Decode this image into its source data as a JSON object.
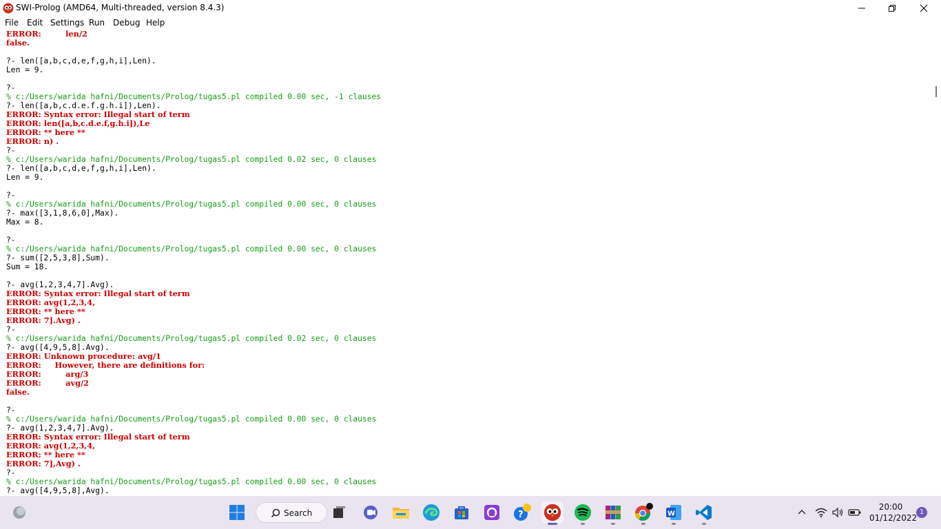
{
  "window": {
    "title": "SWI-Prolog (AMD64, Multi-threaded, version 8.4.3)",
    "controls": [
      "minimize",
      "restore",
      "close"
    ]
  },
  "menu": [
    "File",
    "Edit",
    "Settings",
    "Run",
    "Debug",
    "Help"
  ],
  "colors": {
    "error_text": "#cc0000",
    "comment_text": "#14a014",
    "normal_text": "#000000",
    "taskbar_bg": "#e9e4ef",
    "notification_badge": "#6f58b8"
  },
  "console": {
    "lines": [
      {
        "t": "ERROR:         len/2",
        "k": "error"
      },
      {
        "t": "false.",
        "k": "error"
      },
      {
        "t": "",
        "k": "normal"
      },
      {
        "t": "?- len([a,b,c,d,e,f,g,h,i],Len).",
        "k": "normal"
      },
      {
        "t": "Len = 9.",
        "k": "normal"
      },
      {
        "t": "",
        "k": "normal"
      },
      {
        "t": "?-",
        "k": "normal"
      },
      {
        "t": "% c:/Users/warida hafni/Documents/Prolog/tugas5.pl compiled 0.00 sec, -1 clauses",
        "k": "comment"
      },
      {
        "t": "?- len([a,b,c.d.e.f.g.h.i]),Len).",
        "k": "normal"
      },
      {
        "t": "ERROR: Syntax error: Illegal start of term",
        "k": "error"
      },
      {
        "t": "ERROR: len([a,b,c.d.e.f,g.h.i]),Le",
        "k": "error"
      },
      {
        "t": "ERROR: ** here **",
        "k": "error"
      },
      {
        "t": "ERROR: n) .",
        "k": "error"
      },
      {
        "t": "?-",
        "k": "normal"
      },
      {
        "t": "% c:/Users/warida hafni/Documents/Prolog/tugas5.pl compiled 0.02 sec, 0 clauses",
        "k": "comment"
      },
      {
        "t": "?- len([a,b,c,d,e,f,g,h,i],Len).",
        "k": "normal"
      },
      {
        "t": "Len = 9.",
        "k": "normal"
      },
      {
        "t": "",
        "k": "normal"
      },
      {
        "t": "?-",
        "k": "normal"
      },
      {
        "t": "% c:/Users/warida hafni/Documents/Prolog/tugas5.pl compiled 0.00 sec, 0 clauses",
        "k": "comment"
      },
      {
        "t": "?- max([3,1,8,6,0],Max).",
        "k": "normal"
      },
      {
        "t": "Max = 8.",
        "k": "normal"
      },
      {
        "t": "",
        "k": "normal"
      },
      {
        "t": "?-",
        "k": "normal"
      },
      {
        "t": "% c:/Users/warida hafni/Documents/Prolog/tugas5.pl compiled 0.00 sec, 0 clauses",
        "k": "comment"
      },
      {
        "t": "?- sum([2,5,3,8],Sum).",
        "k": "normal"
      },
      {
        "t": "Sum = 18.",
        "k": "normal"
      },
      {
        "t": "",
        "k": "normal"
      },
      {
        "t": "?- avg(1,2,3,4,7].Avg).",
        "k": "normal"
      },
      {
        "t": "ERROR: Syntax error: Illegal start of term",
        "k": "error"
      },
      {
        "t": "ERROR: avg(1,2,3,4,",
        "k": "error"
      },
      {
        "t": "ERROR: ** here **",
        "k": "error"
      },
      {
        "t": "ERROR: 7].Avg) .",
        "k": "error"
      },
      {
        "t": "?-",
        "k": "normal"
      },
      {
        "t": "% c:/Users/warida hafni/Documents/Prolog/tugas5.pl compiled 0.02 sec, 0 clauses",
        "k": "comment"
      },
      {
        "t": "?- avg([4,9,5,8].Avg).",
        "k": "normal"
      },
      {
        "t": "ERROR: Unknown procedure: avg/1",
        "k": "error"
      },
      {
        "t": "ERROR:     However, there are definitions for:",
        "k": "error"
      },
      {
        "t": "ERROR:         arg/3",
        "k": "error"
      },
      {
        "t": "ERROR:         avg/2",
        "k": "error"
      },
      {
        "t": "false.",
        "k": "error"
      },
      {
        "t": "",
        "k": "normal"
      },
      {
        "t": "?-",
        "k": "normal"
      },
      {
        "t": "% c:/Users/warida hafni/Documents/Prolog/tugas5.pl compiled 0.00 sec, 0 clauses",
        "k": "comment"
      },
      {
        "t": "?- avg(1,2,3,4,7].Avg).",
        "k": "normal"
      },
      {
        "t": "ERROR: Syntax error: Illegal start of term",
        "k": "error"
      },
      {
        "t": "ERROR: avg(1,2,3,4,",
        "k": "error"
      },
      {
        "t": "ERROR: ** here **",
        "k": "error"
      },
      {
        "t": "ERROR: 7],Avg) .",
        "k": "error"
      },
      {
        "t": "?-",
        "k": "normal"
      },
      {
        "t": "% c:/Users/warida hafni/Documents/Prolog/tugas5.pl compiled 0.00 sec, 0 clauses",
        "k": "comment"
      },
      {
        "t": "?- avg([4,9,5,8],Avg).",
        "k": "normal"
      }
    ]
  },
  "taskbar": {
    "search_label": "Search",
    "clock_time": "20:00",
    "clock_date": "01/12/2022",
    "notification_count": "1",
    "apps": [
      {
        "name": "start",
        "icon": "windows-start-icon"
      },
      {
        "name": "task-view",
        "icon": "task-view-icon"
      },
      {
        "name": "chat",
        "icon": "teams-chat-icon"
      },
      {
        "name": "file-explorer",
        "icon": "folder-icon"
      },
      {
        "name": "edge",
        "icon": "edge-icon"
      },
      {
        "name": "store",
        "icon": "store-icon"
      },
      {
        "name": "app-purple",
        "icon": "purple-app-icon"
      },
      {
        "name": "get-help",
        "icon": "help-icon"
      },
      {
        "name": "swi-prolog",
        "icon": "swi-prolog-icon",
        "active": true
      },
      {
        "name": "spotify",
        "icon": "spotify-icon"
      },
      {
        "name": "winrar",
        "icon": "winrar-icon"
      },
      {
        "name": "chrome",
        "icon": "chrome-icon"
      },
      {
        "name": "word",
        "icon": "word-icon"
      },
      {
        "name": "vscode",
        "icon": "vscode-icon"
      }
    ]
  }
}
